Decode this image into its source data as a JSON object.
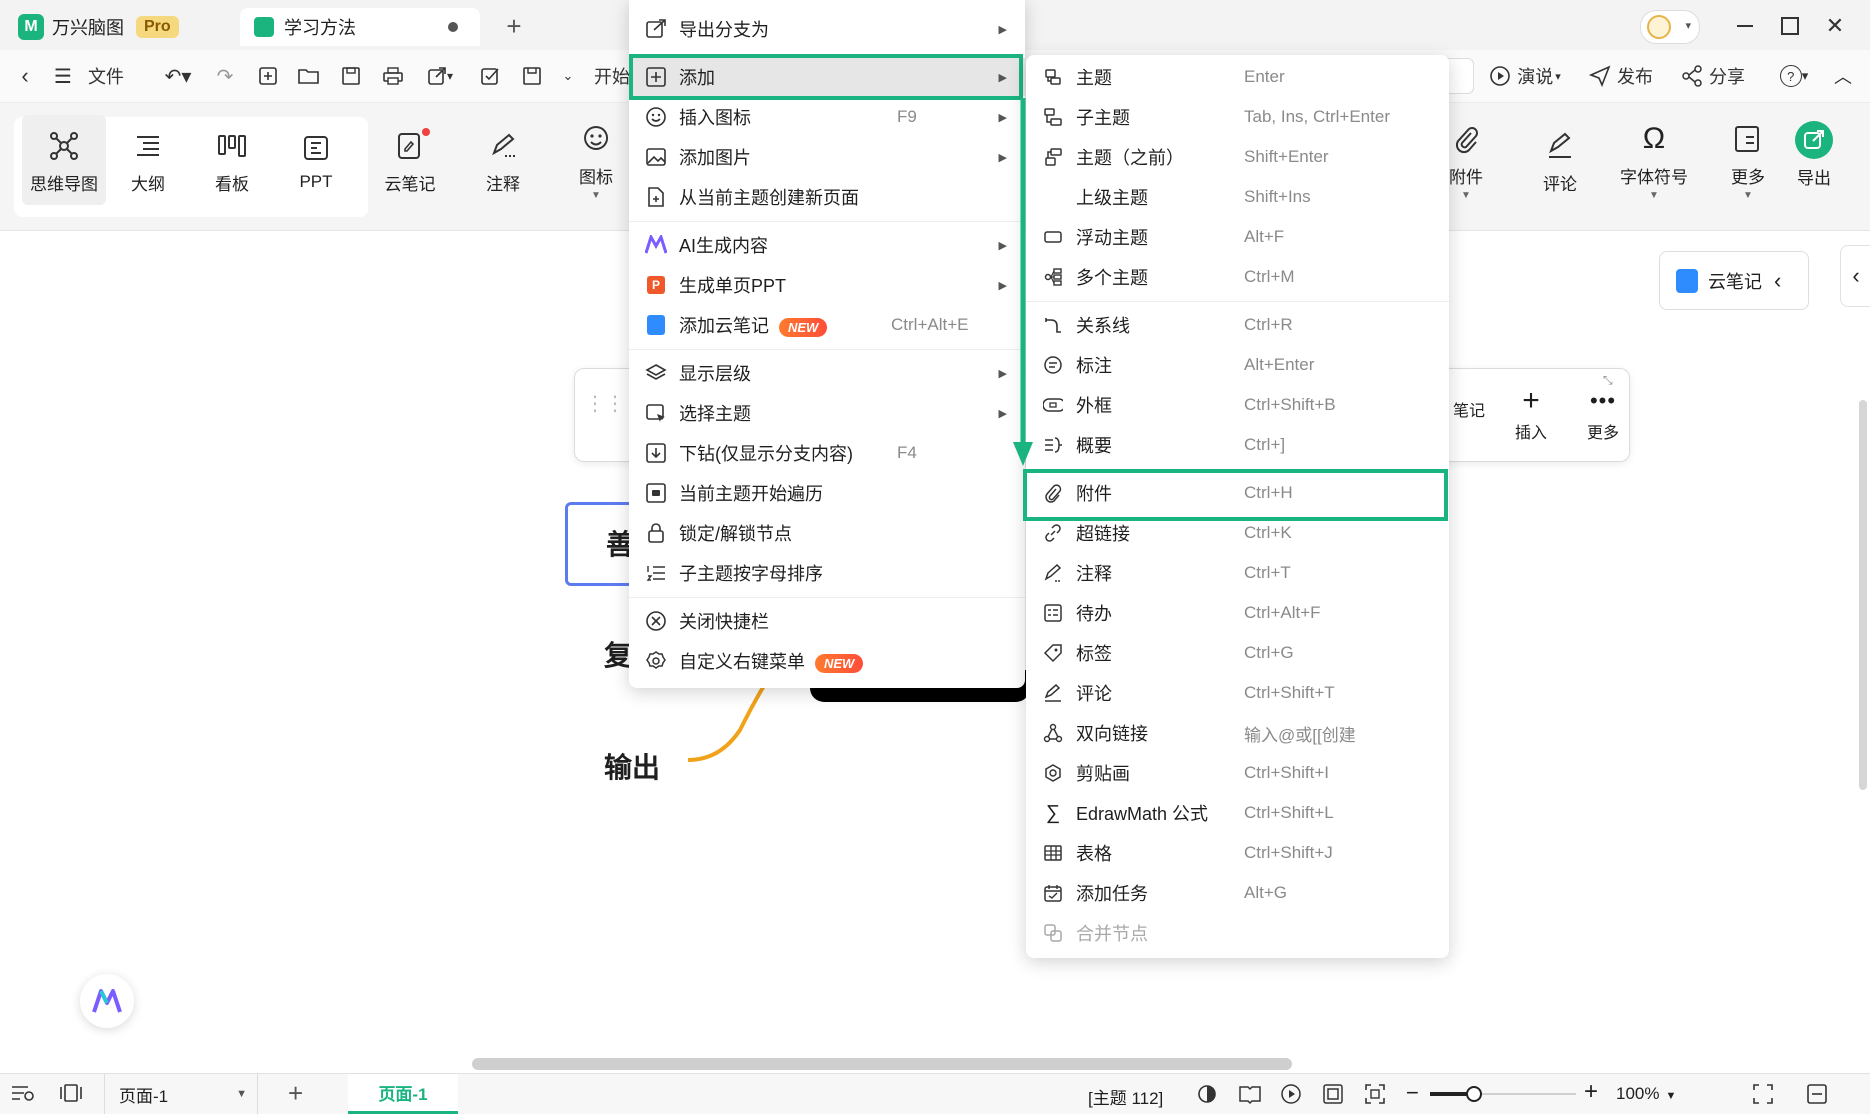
{
  "app": {
    "name": "万兴脑图",
    "badge": "Pro"
  },
  "tabs": [
    {
      "label": "学习方法"
    }
  ],
  "toolbar": {
    "file_label": "文件",
    "start_label": "开始",
    "present_label": "演说",
    "publish_label": "发布",
    "share_label": "分享"
  },
  "ribbon": {
    "left_group": [
      "思维导图",
      "大纲",
      "看板",
      "PPT"
    ],
    "cloud_note": "云笔记",
    "annotate": "注释",
    "icon": "图标",
    "attach": "附件",
    "comment": "评论",
    "symbol": "字体符号",
    "more": "更多",
    "export": "导出"
  },
  "canvas": {
    "cloud_note_chip": "云笔记",
    "float_bar": {
      "note": "笔记",
      "insert": "插入",
      "more": "更多"
    },
    "node_shan": "善",
    "node_fu": "复",
    "node_output": "输出",
    "colors": {
      "accent": "#19b481",
      "branch": "#f0a21a",
      "node_border": "#5b7cf0"
    }
  },
  "context_menu": [
    {
      "label": "导出分支为",
      "arrow": true
    },
    {
      "label": "添加",
      "arrow": true,
      "highlighted": true
    },
    {
      "label": "插入图标",
      "shortcut": "F9",
      "arrow": true
    },
    {
      "label": "添加图片",
      "arrow": true
    },
    {
      "label": "从当前主题创建新页面"
    },
    {
      "label": "AI生成内容",
      "arrow": true
    },
    {
      "label": "生成单页PPT",
      "arrow": true
    },
    {
      "label": "添加云笔记",
      "badge": "NEW",
      "shortcut": "Ctrl+Alt+E"
    },
    {
      "label": "显示层级",
      "arrow": true
    },
    {
      "label": "选择主题",
      "arrow": true
    },
    {
      "label": "下钻(仅显示分支内容)",
      "shortcut": "F4"
    },
    {
      "label": "当前主题开始遍历"
    },
    {
      "label": "锁定/解锁节点"
    },
    {
      "label": "子主题按字母排序"
    },
    {
      "label": "关闭快捷栏"
    },
    {
      "label": "自定义右键菜单",
      "badge": "NEW"
    }
  ],
  "submenu": [
    {
      "label": "主题",
      "shortcut": "Enter"
    },
    {
      "label": "子主题",
      "shortcut": "Tab, Ins, Ctrl+Enter"
    },
    {
      "label": "主题（之前）",
      "shortcut": "Shift+Enter"
    },
    {
      "label": "上级主题",
      "shortcut": "Shift+Ins"
    },
    {
      "label": "浮动主题",
      "shortcut": "Alt+F"
    },
    {
      "label": "多个主题",
      "shortcut": "Ctrl+M"
    },
    {
      "label": "关系线",
      "shortcut": "Ctrl+R"
    },
    {
      "label": "标注",
      "shortcut": "Alt+Enter"
    },
    {
      "label": "外框",
      "shortcut": "Ctrl+Shift+B"
    },
    {
      "label": "概要",
      "shortcut": "Ctrl+]"
    },
    {
      "label": "附件",
      "shortcut": "Ctrl+H",
      "highlighted": true
    },
    {
      "label": "超链接",
      "shortcut": "Ctrl+K"
    },
    {
      "label": "注释",
      "shortcut": "Ctrl+T"
    },
    {
      "label": "待办",
      "shortcut": "Ctrl+Alt+F"
    },
    {
      "label": "标签",
      "shortcut": "Ctrl+G"
    },
    {
      "label": "评论",
      "shortcut": "Ctrl+Shift+T"
    },
    {
      "label": "双向链接",
      "shortcut": "输入@或[[创建"
    },
    {
      "label": "剪贴画",
      "shortcut": "Ctrl+Shift+I"
    },
    {
      "label": "EdrawMath 公式",
      "shortcut": "Ctrl+Shift+L"
    },
    {
      "label": "表格",
      "shortcut": "Ctrl+Shift+J"
    },
    {
      "label": "添加任务",
      "shortcut": "Alt+G"
    },
    {
      "label": "合并节点",
      "disabled": true
    }
  ],
  "status": {
    "page_select": "页面-1",
    "page_tab": "页面-1",
    "topic_count": "[主题 112]",
    "zoom": "100%",
    "zoom_level": 0.3
  }
}
